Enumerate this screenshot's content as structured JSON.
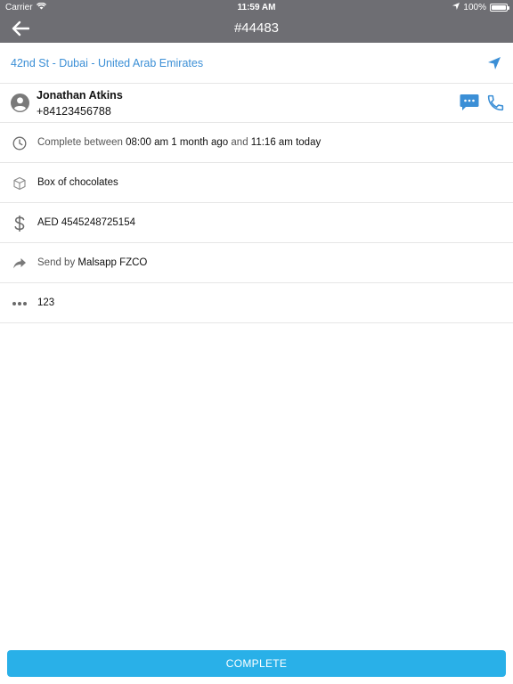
{
  "status_bar": {
    "carrier": "Carrier",
    "time": "11:59 AM",
    "battery": "100%",
    "battery_level": 1.0
  },
  "header": {
    "title": "#44483",
    "back_icon": "arrow-left-icon"
  },
  "address": {
    "text": "42nd St - Dubai - United Arab Emirates",
    "icon": "navigation-arrow-icon"
  },
  "contact": {
    "name": "Jonathan Atkins",
    "phone": "+84123456788",
    "icons": [
      "user-circle-icon",
      "message-icon",
      "phone-icon"
    ]
  },
  "schedule": {
    "prefix": "Complete between",
    "start": "08:00 am 1 month ago",
    "conjunction": "and",
    "end": "11:16 am today"
  },
  "package": {
    "description": "Box of chocolates"
  },
  "payment": {
    "amount": "AED 4545248725154"
  },
  "sender": {
    "prefix": "Send by",
    "name": "Malsapp FZCO"
  },
  "notes": {
    "text": "123"
  },
  "actions": {
    "complete_label": "COMPLETE"
  },
  "colors": {
    "header_bg": "#6e6e73",
    "accent_blue": "#3b8fd6",
    "button_bg": "#29b0e8",
    "divider": "#e6e6e6"
  }
}
